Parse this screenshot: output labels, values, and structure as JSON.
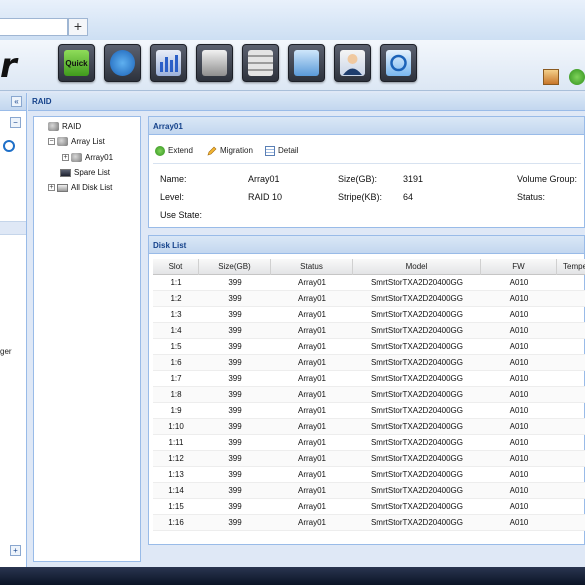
{
  "browser": {
    "new_tab_label": "+"
  },
  "header": {
    "logo_fragment": "r",
    "toolbar": [
      {
        "name": "quick",
        "label": "Quick",
        "icon": "quick-setup-icon",
        "color": "#6abf3a"
      },
      {
        "name": "info",
        "label": "",
        "icon": "info-icon",
        "color": "#2f86d8"
      },
      {
        "name": "monitor",
        "label": "",
        "icon": "performance-monitor-icon",
        "color": "#3a6fd0"
      },
      {
        "name": "disk",
        "label": "",
        "icon": "hard-disk-icon",
        "color": "#9a9a9a"
      },
      {
        "name": "storage",
        "label": "",
        "icon": "storage-cabinet-icon",
        "color": "#b0b0b0"
      },
      {
        "name": "network",
        "label": "",
        "icon": "network-icon",
        "color": "#6aa7e0"
      },
      {
        "name": "user",
        "label": "",
        "icon": "user-icon",
        "color": "#3c6ea5"
      },
      {
        "name": "restore",
        "label": "",
        "icon": "restore-icon",
        "color": "#4aa0e8"
      }
    ],
    "right_icons": [
      "log-out-icon",
      "help-icon"
    ]
  },
  "left_panel": {
    "collapse_label": "«",
    "minus_label": "−",
    "plus_label": "+",
    "partial_text": "ger"
  },
  "main": {
    "title": "RAID",
    "tree": {
      "root": "RAID",
      "array_list": "Array List",
      "array01": "Array01",
      "spare_list": "Spare List",
      "all_disk_list": "All Disk List"
    },
    "array_panel": {
      "title": "Array01",
      "actions": {
        "extend": "Extend",
        "migration": "Migration",
        "detail": "Detail"
      },
      "fields": {
        "name_label": "Name:",
        "name_value": "Array01",
        "size_label": "Size(GB):",
        "size_value": "3191",
        "volume_group_label": "Volume Group:",
        "level_label": "Level:",
        "level_value": "RAID 10",
        "stripe_label": "Stripe(KB):",
        "stripe_value": "64",
        "status_label": "Status:",
        "use_state_label": "Use State:"
      }
    },
    "disk_list": {
      "title": "Disk List",
      "columns": [
        "Slot",
        "Size(GB)",
        "Status",
        "Model",
        "FW",
        "Tempe"
      ],
      "rows": [
        [
          "1:1",
          "399",
          "Array01",
          "SmrtStorTXA2D20400GG",
          "A010"
        ],
        [
          "1:2",
          "399",
          "Array01",
          "SmrtStorTXA2D20400GG",
          "A010"
        ],
        [
          "1:3",
          "399",
          "Array01",
          "SmrtStorTXA2D20400GG",
          "A010"
        ],
        [
          "1:4",
          "399",
          "Array01",
          "SmrtStorTXA2D20400GG",
          "A010"
        ],
        [
          "1:5",
          "399",
          "Array01",
          "SmrtStorTXA2D20400GG",
          "A010"
        ],
        [
          "1:6",
          "399",
          "Array01",
          "SmrtStorTXA2D20400GG",
          "A010"
        ],
        [
          "1:7",
          "399",
          "Array01",
          "SmrtStorTXA2D20400GG",
          "A010"
        ],
        [
          "1:8",
          "399",
          "Array01",
          "SmrtStorTXA2D20400GG",
          "A010"
        ],
        [
          "1:9",
          "399",
          "Array01",
          "SmrtStorTXA2D20400GG",
          "A010"
        ],
        [
          "1:10",
          "399",
          "Array01",
          "SmrtStorTXA2D20400GG",
          "A010"
        ],
        [
          "1:11",
          "399",
          "Array01",
          "SmrtStorTXA2D20400GG",
          "A010"
        ],
        [
          "1:12",
          "399",
          "Array01",
          "SmrtStorTXA2D20400GG",
          "A010"
        ],
        [
          "1:13",
          "399",
          "Array01",
          "SmrtStorTXA2D20400GG",
          "A010"
        ],
        [
          "1:14",
          "399",
          "Array01",
          "SmrtStorTXA2D20400GG",
          "A010"
        ],
        [
          "1:15",
          "399",
          "Array01",
          "SmrtStorTXA2D20400GG",
          "A010"
        ],
        [
          "1:16",
          "399",
          "Array01",
          "SmrtStorTXA2D20400GG",
          "A010"
        ]
      ]
    }
  }
}
